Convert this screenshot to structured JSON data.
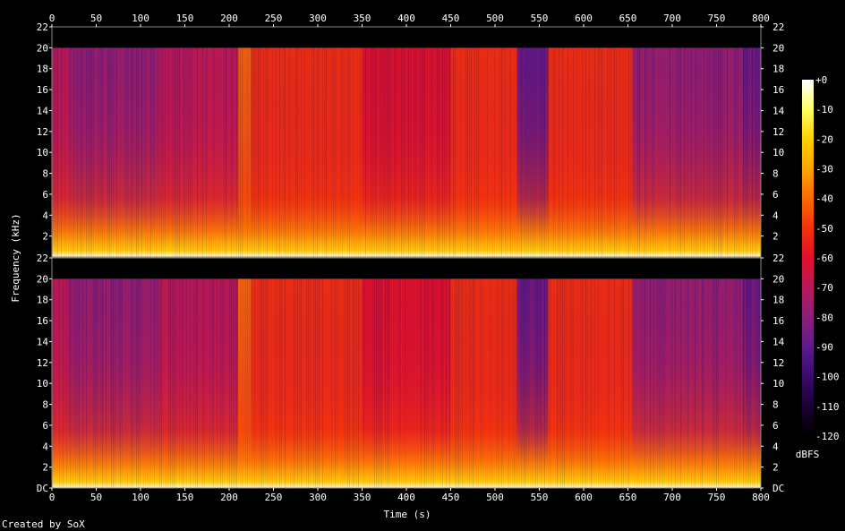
{
  "chart_data": {
    "type": "heatmap",
    "xlabel": "Time (s)",
    "ylabel": "Frequency (kHz)",
    "colorbar_label": "dBFS",
    "credit": "Created by SoX",
    "x_ticks": [
      0,
      50,
      100,
      150,
      200,
      250,
      300,
      350,
      400,
      450,
      500,
      550,
      600,
      650,
      700,
      750,
      800
    ],
    "xlim": [
      0,
      800
    ],
    "y_ticks": [
      "DC",
      "2",
      "4",
      "6",
      "8",
      "10",
      "12",
      "14",
      "16",
      "18",
      "20",
      "22"
    ],
    "ylim_khz": [
      0,
      22
    ],
    "colorbar_ticks": [
      "+0",
      "-10",
      "-20",
      "-30",
      "-40",
      "-50",
      "-60",
      "-70",
      "-80",
      "-90",
      "-100",
      "-110",
      "-120"
    ],
    "colorbar_range_dbfs": [
      -120,
      0
    ],
    "channels": 2,
    "content_cutoff_khz": 20,
    "colormap": [
      "#000000",
      "#1a0033",
      "#3a0a6e",
      "#5e1a8c",
      "#8a1f7a",
      "#b8195a",
      "#e0102a",
      "#f5300a",
      "#fb6a00",
      "#ffa500",
      "#ffd000",
      "#ffff60",
      "#ffffff"
    ],
    "time_segments": [
      {
        "start": 0,
        "end": 20,
        "level_dbfs": -75
      },
      {
        "start": 20,
        "end": 120,
        "level_dbfs": -80
      },
      {
        "start": 120,
        "end": 210,
        "level_dbfs": -68
      },
      {
        "start": 210,
        "end": 225,
        "level_dbfs": -45
      },
      {
        "start": 225,
        "end": 350,
        "level_dbfs": -55
      },
      {
        "start": 350,
        "end": 450,
        "level_dbfs": -63
      },
      {
        "start": 450,
        "end": 525,
        "level_dbfs": -50
      },
      {
        "start": 525,
        "end": 560,
        "level_dbfs": -88
      },
      {
        "start": 560,
        "end": 655,
        "level_dbfs": -52
      },
      {
        "start": 655,
        "end": 780,
        "level_dbfs": -78
      },
      {
        "start": 780,
        "end": 800,
        "level_dbfs": -95
      }
    ]
  }
}
